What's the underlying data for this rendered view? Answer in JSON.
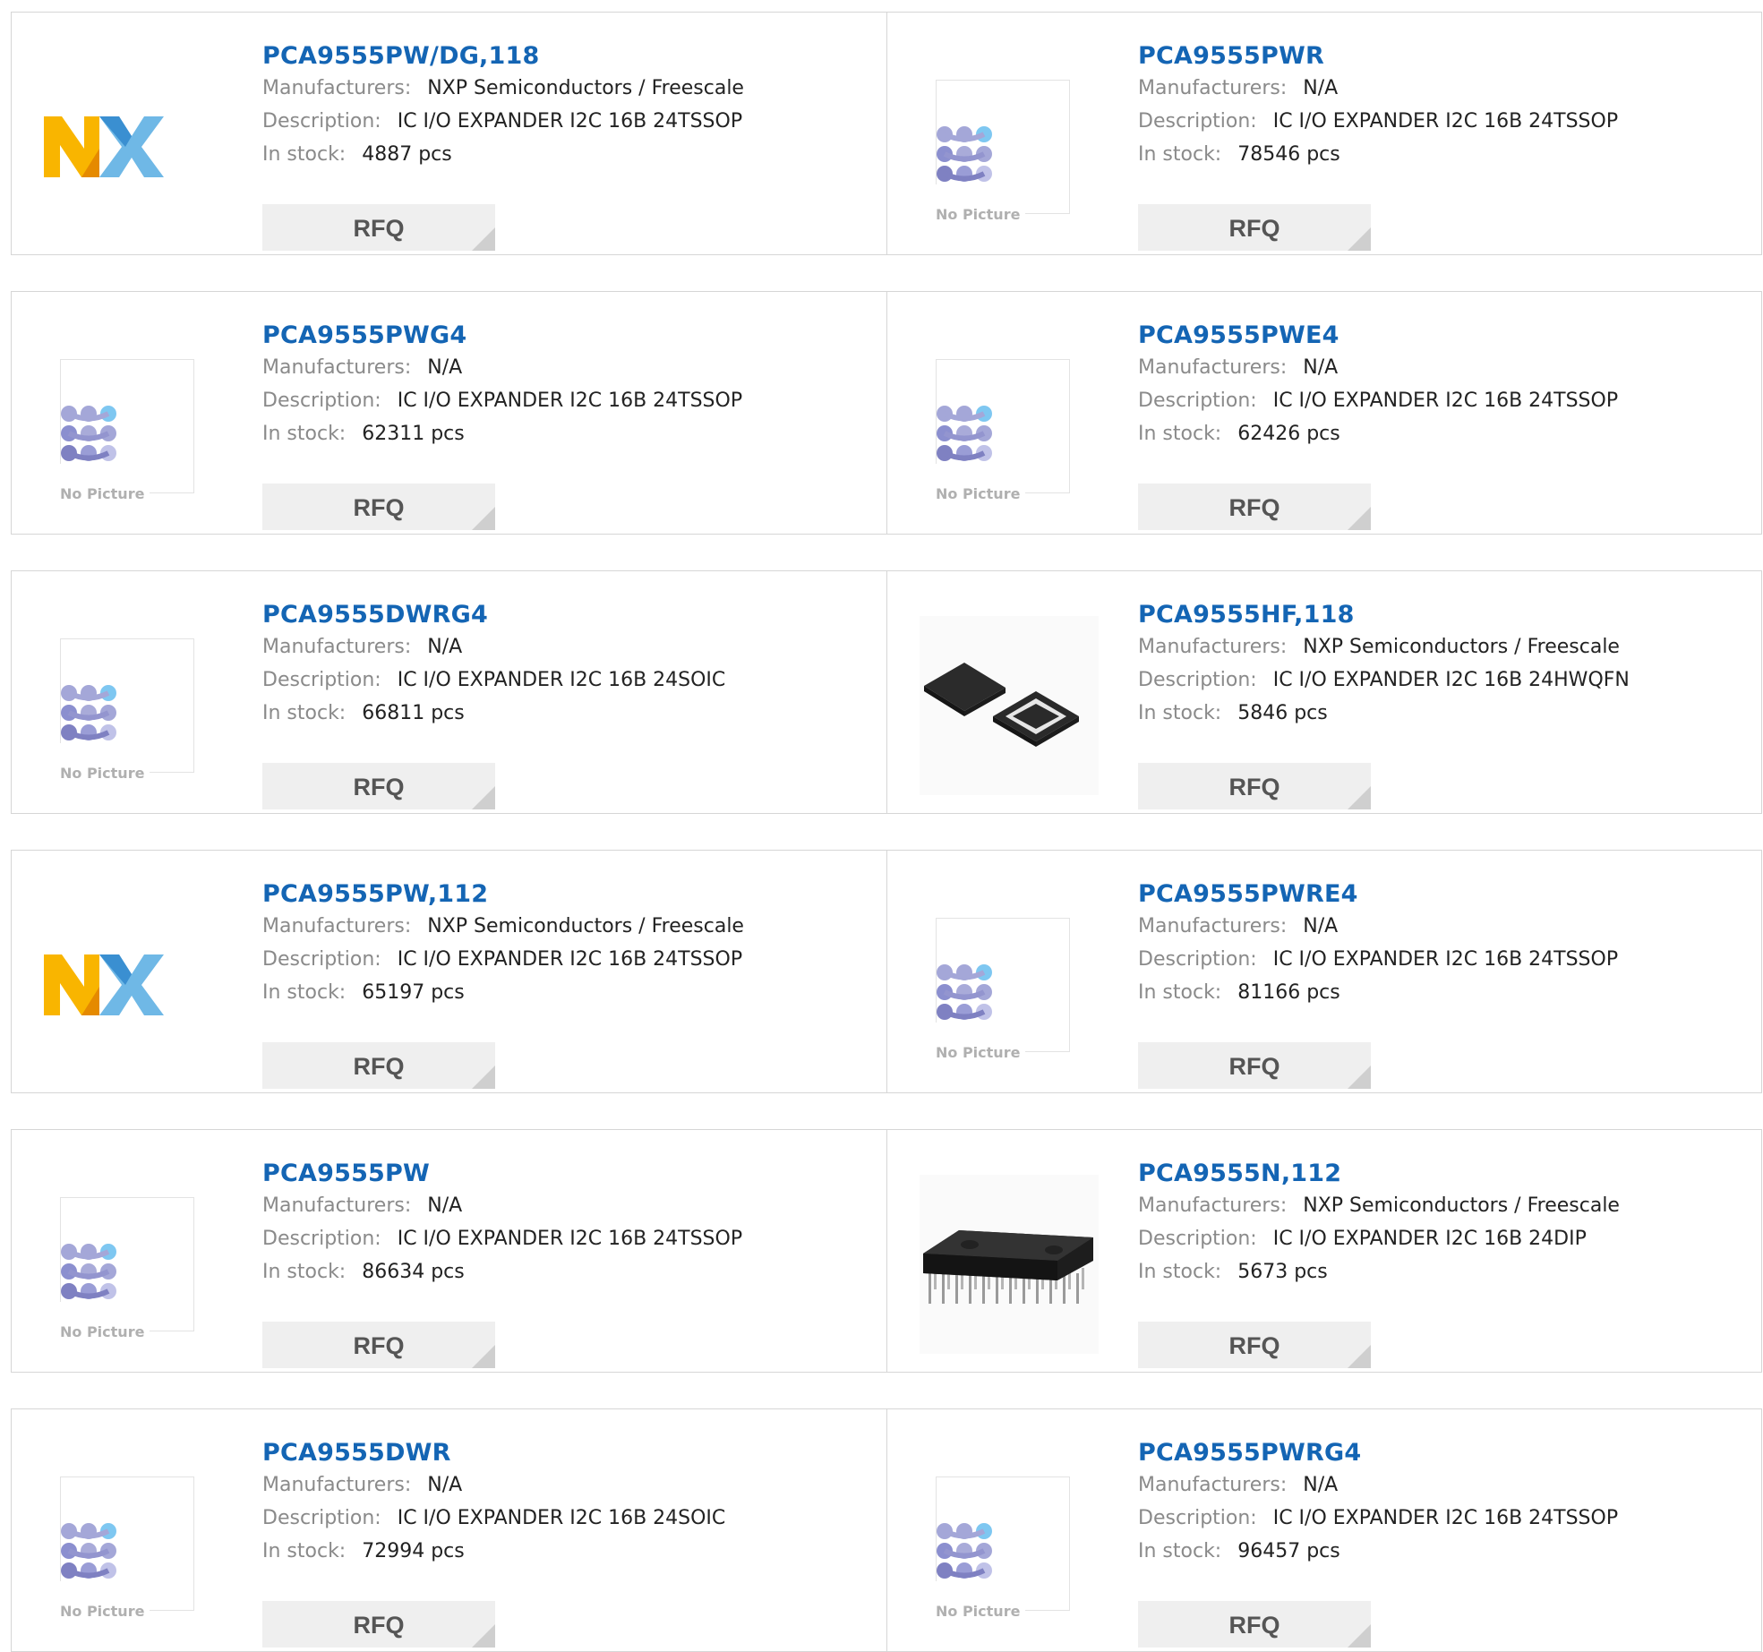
{
  "labels": {
    "manufacturers": "Manufacturers:",
    "description": "Description:",
    "stock": "In stock:",
    "rfq": "RFQ",
    "no_picture": "No Picture"
  },
  "products": [
    {
      "part": "PCA9555PW/DG,118",
      "manufacturer": "NXP Semiconductors / Freescale",
      "description": "IC I/O EXPANDER I2C 16B 24TSSOP",
      "stock": "4887 pcs",
      "image": "nxp-logo"
    },
    {
      "part": "PCA9555PWR",
      "manufacturer": "N/A",
      "description": "IC I/O EXPANDER I2C 16B 24TSSOP",
      "stock": "78546 pcs",
      "image": "no-picture"
    },
    {
      "part": "PCA9555PWG4",
      "manufacturer": "N/A",
      "description": "IC I/O EXPANDER I2C 16B 24TSSOP",
      "stock": "62311 pcs",
      "image": "no-picture"
    },
    {
      "part": "PCA9555PWE4",
      "manufacturer": "N/A",
      "description": "IC I/O EXPANDER I2C 16B 24TSSOP",
      "stock": "62426 pcs",
      "image": "no-picture"
    },
    {
      "part": "PCA9555DWRG4",
      "manufacturer": "N/A",
      "description": "IC I/O EXPANDER I2C 16B 24SOIC",
      "stock": "66811 pcs",
      "image": "no-picture"
    },
    {
      "part": "PCA9555HF,118",
      "manufacturer": "NXP Semiconductors / Freescale",
      "description": "IC I/O EXPANDER I2C 16B 24HWQFN",
      "stock": "5846 pcs",
      "image": "qfn-chip"
    },
    {
      "part": "PCA9555PW,112",
      "manufacturer": "NXP Semiconductors / Freescale",
      "description": "IC I/O EXPANDER I2C 16B 24TSSOP",
      "stock": "65197 pcs",
      "image": "nxp-logo"
    },
    {
      "part": "PCA9555PWRE4",
      "manufacturer": "N/A",
      "description": "IC I/O EXPANDER I2C 16B 24TSSOP",
      "stock": "81166 pcs",
      "image": "no-picture"
    },
    {
      "part": "PCA9555PW",
      "manufacturer": "N/A",
      "description": "IC I/O EXPANDER I2C 16B 24TSSOP",
      "stock": "86634 pcs",
      "image": "no-picture"
    },
    {
      "part": "PCA9555N,112",
      "manufacturer": "NXP Semiconductors / Freescale",
      "description": "IC I/O EXPANDER I2C 16B 24DIP",
      "stock": "5673 pcs",
      "image": "dip-chip"
    },
    {
      "part": "PCA9555DWR",
      "manufacturer": "N/A",
      "description": "IC I/O EXPANDER I2C 16B 24SOIC",
      "stock": "72994 pcs",
      "image": "no-picture"
    },
    {
      "part": "PCA9555PWRG4",
      "manufacturer": "N/A",
      "description": "IC I/O EXPANDER I2C 16B 24TSSOP",
      "stock": "96457 pcs",
      "image": "no-picture"
    }
  ]
}
